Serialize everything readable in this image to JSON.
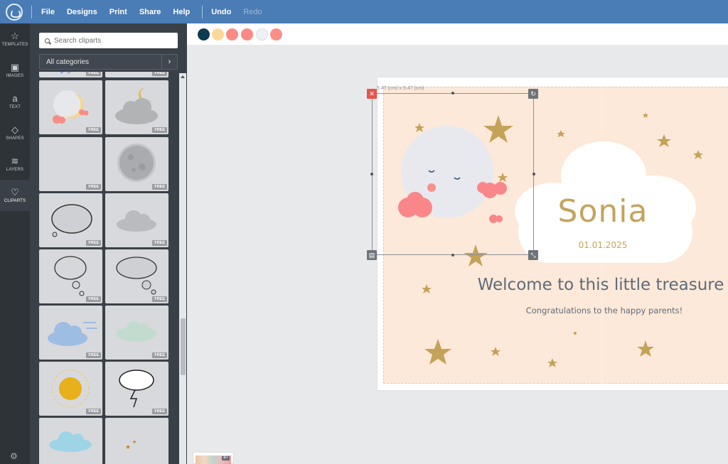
{
  "topbar": {
    "menu": [
      "File",
      "Designs",
      "Print",
      "Share",
      "Help"
    ],
    "undo": "Undo",
    "redo": "Redo"
  },
  "rail": {
    "items": [
      {
        "label": "TEMPLATES",
        "icon": "star-icon",
        "glyph": "☆"
      },
      {
        "label": "IMAGES",
        "icon": "image-icon",
        "glyph": "▣"
      },
      {
        "label": "TEXT",
        "icon": "text-icon",
        "glyph": "a"
      },
      {
        "label": "SHAPES",
        "icon": "diamond-icon",
        "glyph": "◇"
      },
      {
        "label": "LAYERS",
        "icon": "layers-icon",
        "glyph": "≋"
      },
      {
        "label": "CLIPARTS",
        "icon": "heart-icon",
        "glyph": "♡"
      }
    ],
    "active": "CLIPARTS"
  },
  "panel": {
    "search_placeholder": "Search cliparts",
    "category": "All categories",
    "badge": "FREE"
  },
  "swatches": [
    "#0d3b4f",
    "#fcd99a",
    "#f98b83",
    "#fb8a86",
    "#eff0f5",
    "#fb8f87"
  ],
  "canvas": {
    "name": "Sonia",
    "date": "01.01.2025",
    "welcome": "Welcome to this little treasure",
    "congrats": "Congratulations to the happy parents!",
    "selection_size": "5.47 (cm) x 5.47 (cm)"
  },
  "pages": {
    "badge": "4+"
  }
}
